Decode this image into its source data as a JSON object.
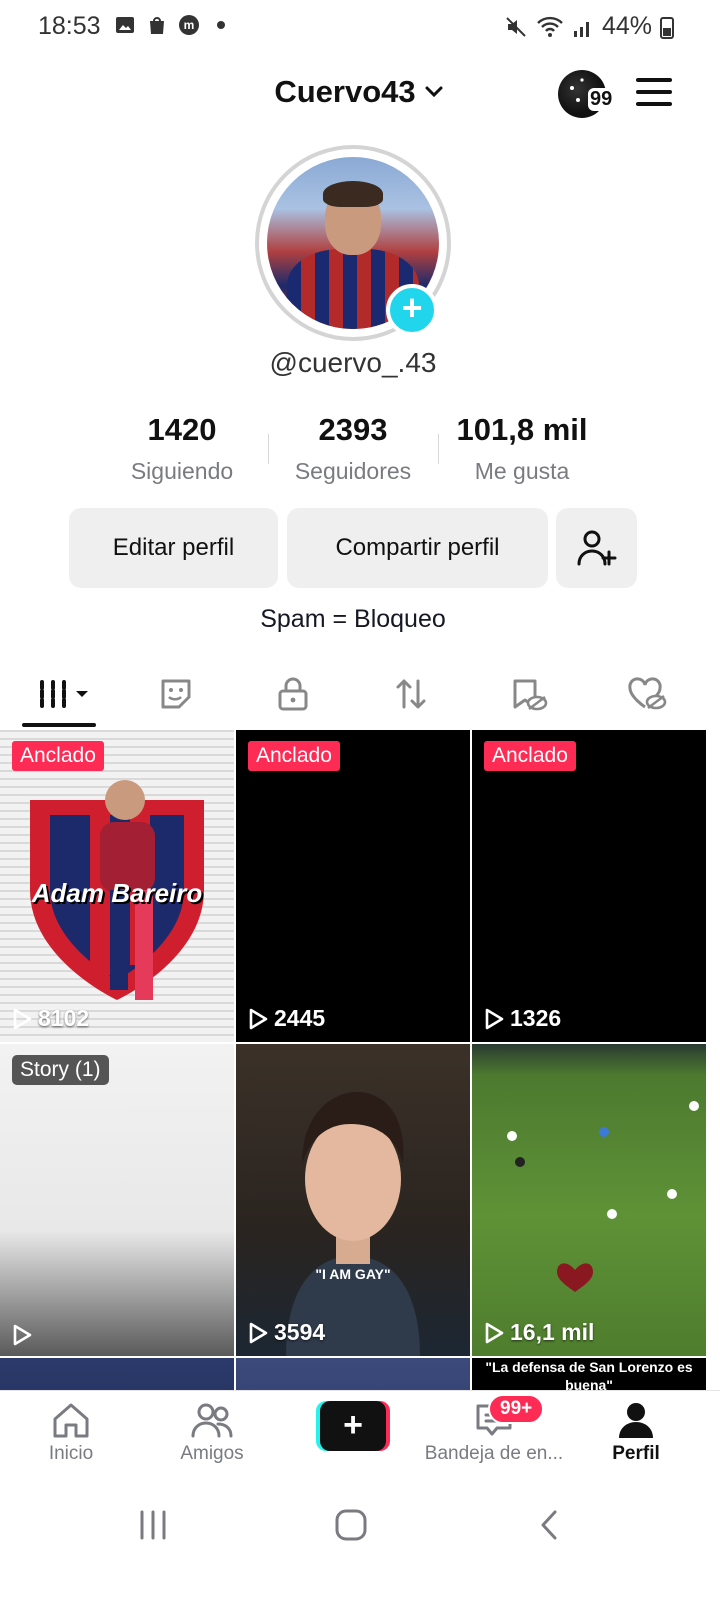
{
  "status_bar": {
    "time": "18:53",
    "battery": "44%"
  },
  "header": {
    "username": "Cuervo43",
    "story_count": "99"
  },
  "profile": {
    "handle": "@cuervo_.43",
    "stats": [
      {
        "value": "1420",
        "label": "Siguiendo"
      },
      {
        "value": "2393",
        "label": "Seguidores"
      },
      {
        "value": "101,8 mil",
        "label": "Me gusta"
      }
    ],
    "edit_label": "Editar perfil",
    "share_label": "Compartir perfil",
    "bio": "Spam = Bloqueo"
  },
  "tabs": [
    "videos-tab",
    "favorites-tab",
    "private-tab",
    "reposts-tab",
    "saved-tab",
    "liked-tab"
  ],
  "videos": [
    {
      "badge": "Anclado",
      "views": "8102",
      "overlay": "Adam Bareiro"
    },
    {
      "badge": "Anclado",
      "views": "2445"
    },
    {
      "badge": "Anclado",
      "views": "1326"
    },
    {
      "badge": "Story (1)",
      "views": ""
    },
    {
      "views": "3594",
      "overlay": "\"I AM GAY\""
    },
    {
      "views": "16,1 mil"
    },
    {
      "overlay": "\"La defensa de San Lorenzo es buena\""
    }
  ],
  "bottom_nav": {
    "home": "Inicio",
    "friends": "Amigos",
    "inbox": "Bandeja de en...",
    "inbox_badge": "99+",
    "profile": "Perfil"
  },
  "colors": {
    "accent": "#fe2c55",
    "cyan": "#20d5ec",
    "text": "#161823",
    "muted": "#7a7b80"
  }
}
